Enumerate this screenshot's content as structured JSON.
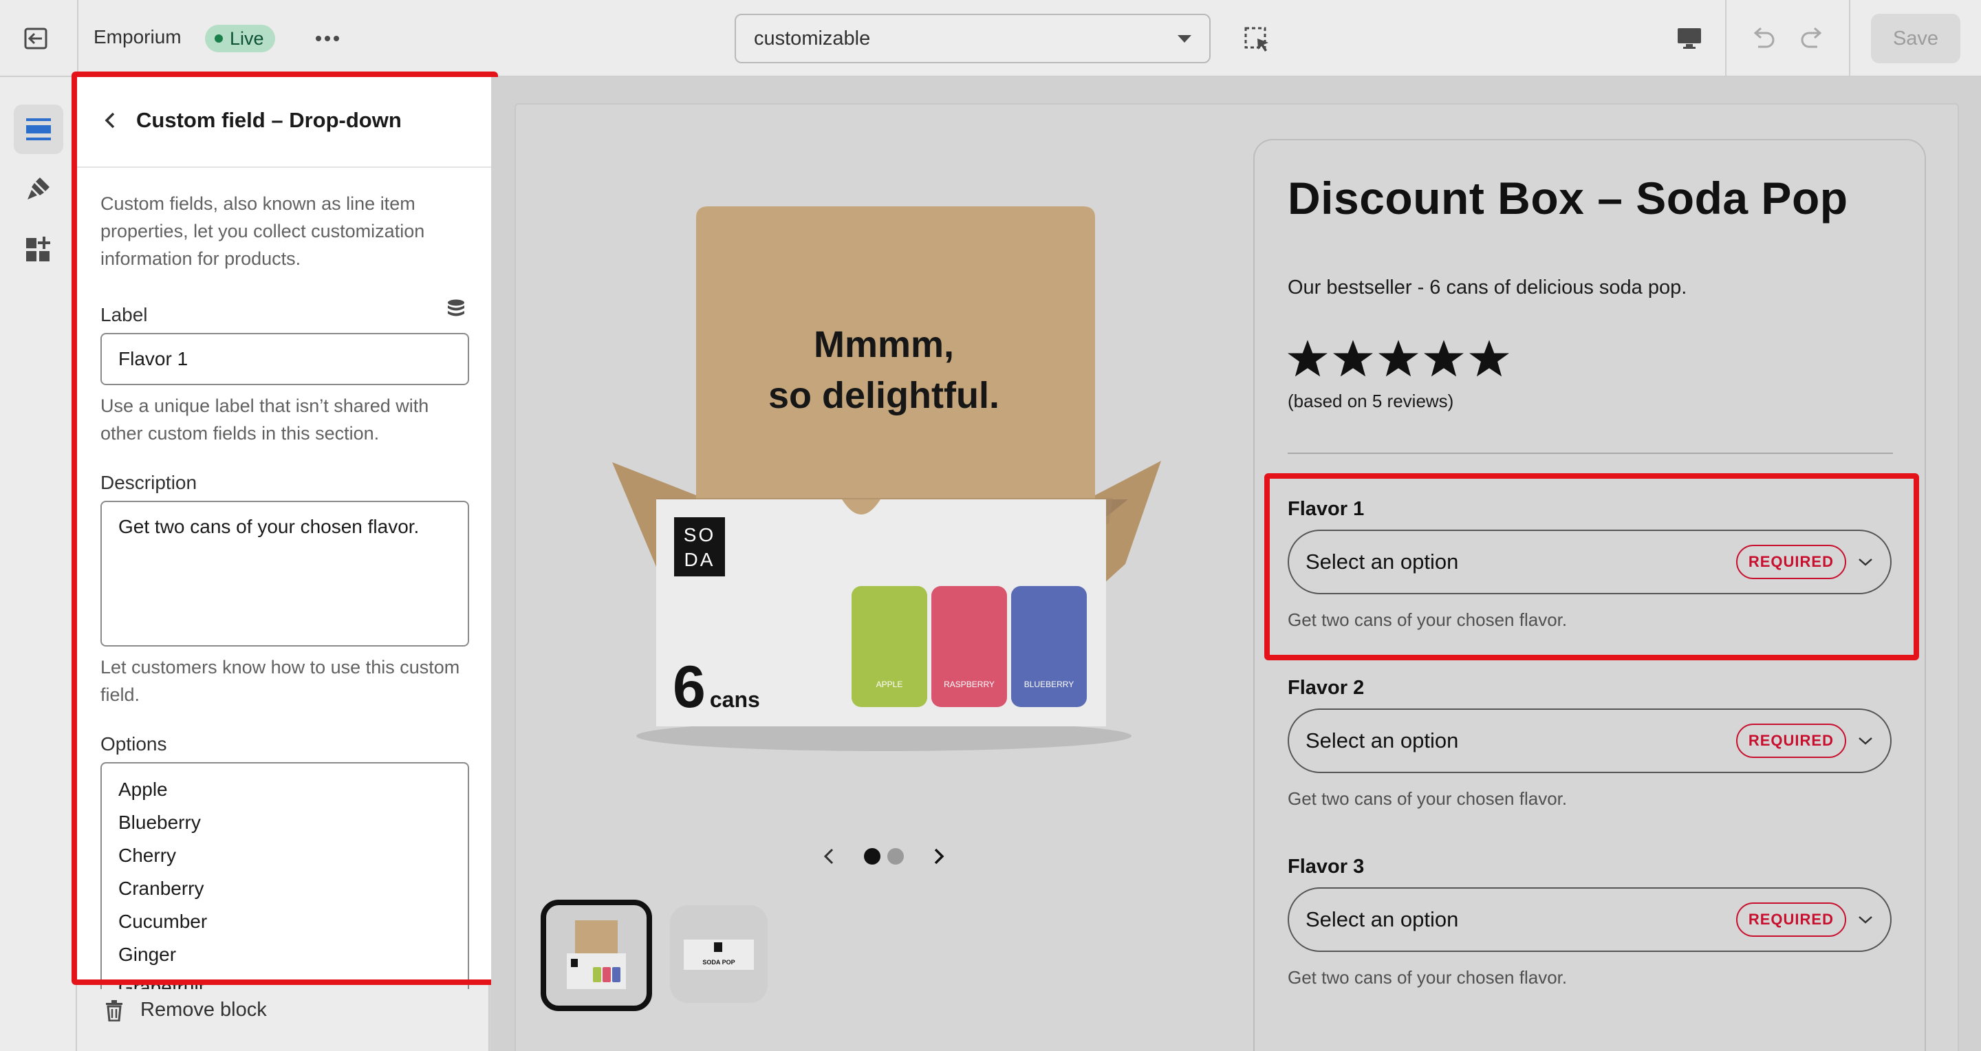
{
  "topbar": {
    "store_name": "Emporium",
    "status_badge": "Live",
    "template_value": "customizable",
    "save_label": "Save"
  },
  "panel": {
    "title": "Custom field – Drop-down",
    "intro": "Custom fields, also known as line item properties, let you collect customization information for products.",
    "label_field": {
      "label": "Label",
      "value": "Flavor 1",
      "help": "Use a unique label that isn’t shared with other custom fields in this section."
    },
    "description_field": {
      "label": "Description",
      "value": "Get two cans of your chosen flavor.",
      "help": "Let customers know how to use this custom field."
    },
    "options_field": {
      "label": "Options",
      "items": [
        "Apple",
        "Blueberry",
        "Cherry",
        "Cranberry",
        "Cucumber",
        "Ginger",
        "Grapefruit"
      ]
    },
    "remove_label": "Remove block"
  },
  "product": {
    "title": "Discount Box – Soda Pop",
    "description": "Our bestseller - 6 cans of delicious soda pop.",
    "rating": 5,
    "reviews_text": "(based on 5 reviews)",
    "image_headline_1": "Mmmm,",
    "image_headline_2": "so delightful.",
    "box_brand": "SO DA",
    "box_count": "6",
    "box_count_unit": "cans",
    "can_flavors": [
      "APPLE",
      "RASPBERRY",
      "BLUEBERRY"
    ],
    "thumb2_text": "SODA POP",
    "fields": [
      {
        "label": "Flavor 1",
        "placeholder": "Select an option",
        "badge": "REQUIRED",
        "help": "Get two cans of your chosen flavor."
      },
      {
        "label": "Flavor 2",
        "placeholder": "Select an option",
        "badge": "REQUIRED",
        "help": "Get two cans of your chosen flavor."
      },
      {
        "label": "Flavor 3",
        "placeholder": "Select an option",
        "badge": "REQUIRED",
        "help": "Get two cans of your chosen flavor."
      }
    ]
  },
  "colors": {
    "highlight": "#e4131a",
    "required": "#c8102e",
    "live_bg": "#b5dec6",
    "apple_can": "#a6c24a",
    "raspberry_can": "#d8556d",
    "blueberry_can": "#5a6bb5"
  }
}
